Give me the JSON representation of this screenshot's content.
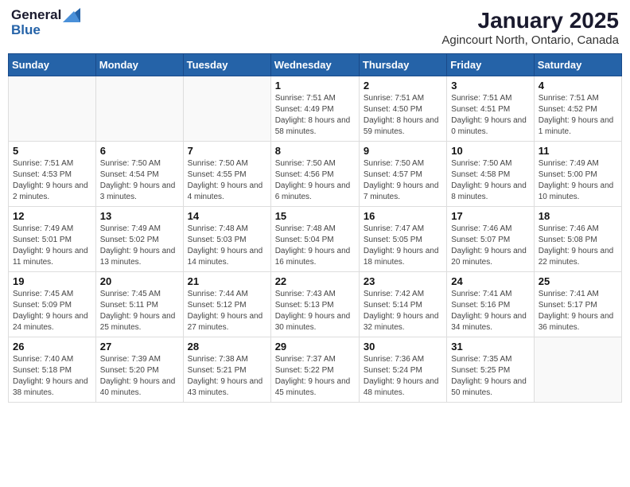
{
  "logo": {
    "general": "General",
    "blue": "Blue"
  },
  "title": "January 2025",
  "subtitle": "Agincourt North, Ontario, Canada",
  "weekdays": [
    "Sunday",
    "Monday",
    "Tuesday",
    "Wednesday",
    "Thursday",
    "Friday",
    "Saturday"
  ],
  "weeks": [
    [
      {
        "day": "",
        "info": ""
      },
      {
        "day": "",
        "info": ""
      },
      {
        "day": "",
        "info": ""
      },
      {
        "day": "1",
        "info": "Sunrise: 7:51 AM\nSunset: 4:49 PM\nDaylight: 8 hours and 58 minutes."
      },
      {
        "day": "2",
        "info": "Sunrise: 7:51 AM\nSunset: 4:50 PM\nDaylight: 8 hours and 59 minutes."
      },
      {
        "day": "3",
        "info": "Sunrise: 7:51 AM\nSunset: 4:51 PM\nDaylight: 9 hours and 0 minutes."
      },
      {
        "day": "4",
        "info": "Sunrise: 7:51 AM\nSunset: 4:52 PM\nDaylight: 9 hours and 1 minute."
      }
    ],
    [
      {
        "day": "5",
        "info": "Sunrise: 7:51 AM\nSunset: 4:53 PM\nDaylight: 9 hours and 2 minutes."
      },
      {
        "day": "6",
        "info": "Sunrise: 7:50 AM\nSunset: 4:54 PM\nDaylight: 9 hours and 3 minutes."
      },
      {
        "day": "7",
        "info": "Sunrise: 7:50 AM\nSunset: 4:55 PM\nDaylight: 9 hours and 4 minutes."
      },
      {
        "day": "8",
        "info": "Sunrise: 7:50 AM\nSunset: 4:56 PM\nDaylight: 9 hours and 6 minutes."
      },
      {
        "day": "9",
        "info": "Sunrise: 7:50 AM\nSunset: 4:57 PM\nDaylight: 9 hours and 7 minutes."
      },
      {
        "day": "10",
        "info": "Sunrise: 7:50 AM\nSunset: 4:58 PM\nDaylight: 9 hours and 8 minutes."
      },
      {
        "day": "11",
        "info": "Sunrise: 7:49 AM\nSunset: 5:00 PM\nDaylight: 9 hours and 10 minutes."
      }
    ],
    [
      {
        "day": "12",
        "info": "Sunrise: 7:49 AM\nSunset: 5:01 PM\nDaylight: 9 hours and 11 minutes."
      },
      {
        "day": "13",
        "info": "Sunrise: 7:49 AM\nSunset: 5:02 PM\nDaylight: 9 hours and 13 minutes."
      },
      {
        "day": "14",
        "info": "Sunrise: 7:48 AM\nSunset: 5:03 PM\nDaylight: 9 hours and 14 minutes."
      },
      {
        "day": "15",
        "info": "Sunrise: 7:48 AM\nSunset: 5:04 PM\nDaylight: 9 hours and 16 minutes."
      },
      {
        "day": "16",
        "info": "Sunrise: 7:47 AM\nSunset: 5:05 PM\nDaylight: 9 hours and 18 minutes."
      },
      {
        "day": "17",
        "info": "Sunrise: 7:46 AM\nSunset: 5:07 PM\nDaylight: 9 hours and 20 minutes."
      },
      {
        "day": "18",
        "info": "Sunrise: 7:46 AM\nSunset: 5:08 PM\nDaylight: 9 hours and 22 minutes."
      }
    ],
    [
      {
        "day": "19",
        "info": "Sunrise: 7:45 AM\nSunset: 5:09 PM\nDaylight: 9 hours and 24 minutes."
      },
      {
        "day": "20",
        "info": "Sunrise: 7:45 AM\nSunset: 5:11 PM\nDaylight: 9 hours and 25 minutes."
      },
      {
        "day": "21",
        "info": "Sunrise: 7:44 AM\nSunset: 5:12 PM\nDaylight: 9 hours and 27 minutes."
      },
      {
        "day": "22",
        "info": "Sunrise: 7:43 AM\nSunset: 5:13 PM\nDaylight: 9 hours and 30 minutes."
      },
      {
        "day": "23",
        "info": "Sunrise: 7:42 AM\nSunset: 5:14 PM\nDaylight: 9 hours and 32 minutes."
      },
      {
        "day": "24",
        "info": "Sunrise: 7:41 AM\nSunset: 5:16 PM\nDaylight: 9 hours and 34 minutes."
      },
      {
        "day": "25",
        "info": "Sunrise: 7:41 AM\nSunset: 5:17 PM\nDaylight: 9 hours and 36 minutes."
      }
    ],
    [
      {
        "day": "26",
        "info": "Sunrise: 7:40 AM\nSunset: 5:18 PM\nDaylight: 9 hours and 38 minutes."
      },
      {
        "day": "27",
        "info": "Sunrise: 7:39 AM\nSunset: 5:20 PM\nDaylight: 9 hours and 40 minutes."
      },
      {
        "day": "28",
        "info": "Sunrise: 7:38 AM\nSunset: 5:21 PM\nDaylight: 9 hours and 43 minutes."
      },
      {
        "day": "29",
        "info": "Sunrise: 7:37 AM\nSunset: 5:22 PM\nDaylight: 9 hours and 45 minutes."
      },
      {
        "day": "30",
        "info": "Sunrise: 7:36 AM\nSunset: 5:24 PM\nDaylight: 9 hours and 48 minutes."
      },
      {
        "day": "31",
        "info": "Sunrise: 7:35 AM\nSunset: 5:25 PM\nDaylight: 9 hours and 50 minutes."
      },
      {
        "day": "",
        "info": ""
      }
    ]
  ]
}
